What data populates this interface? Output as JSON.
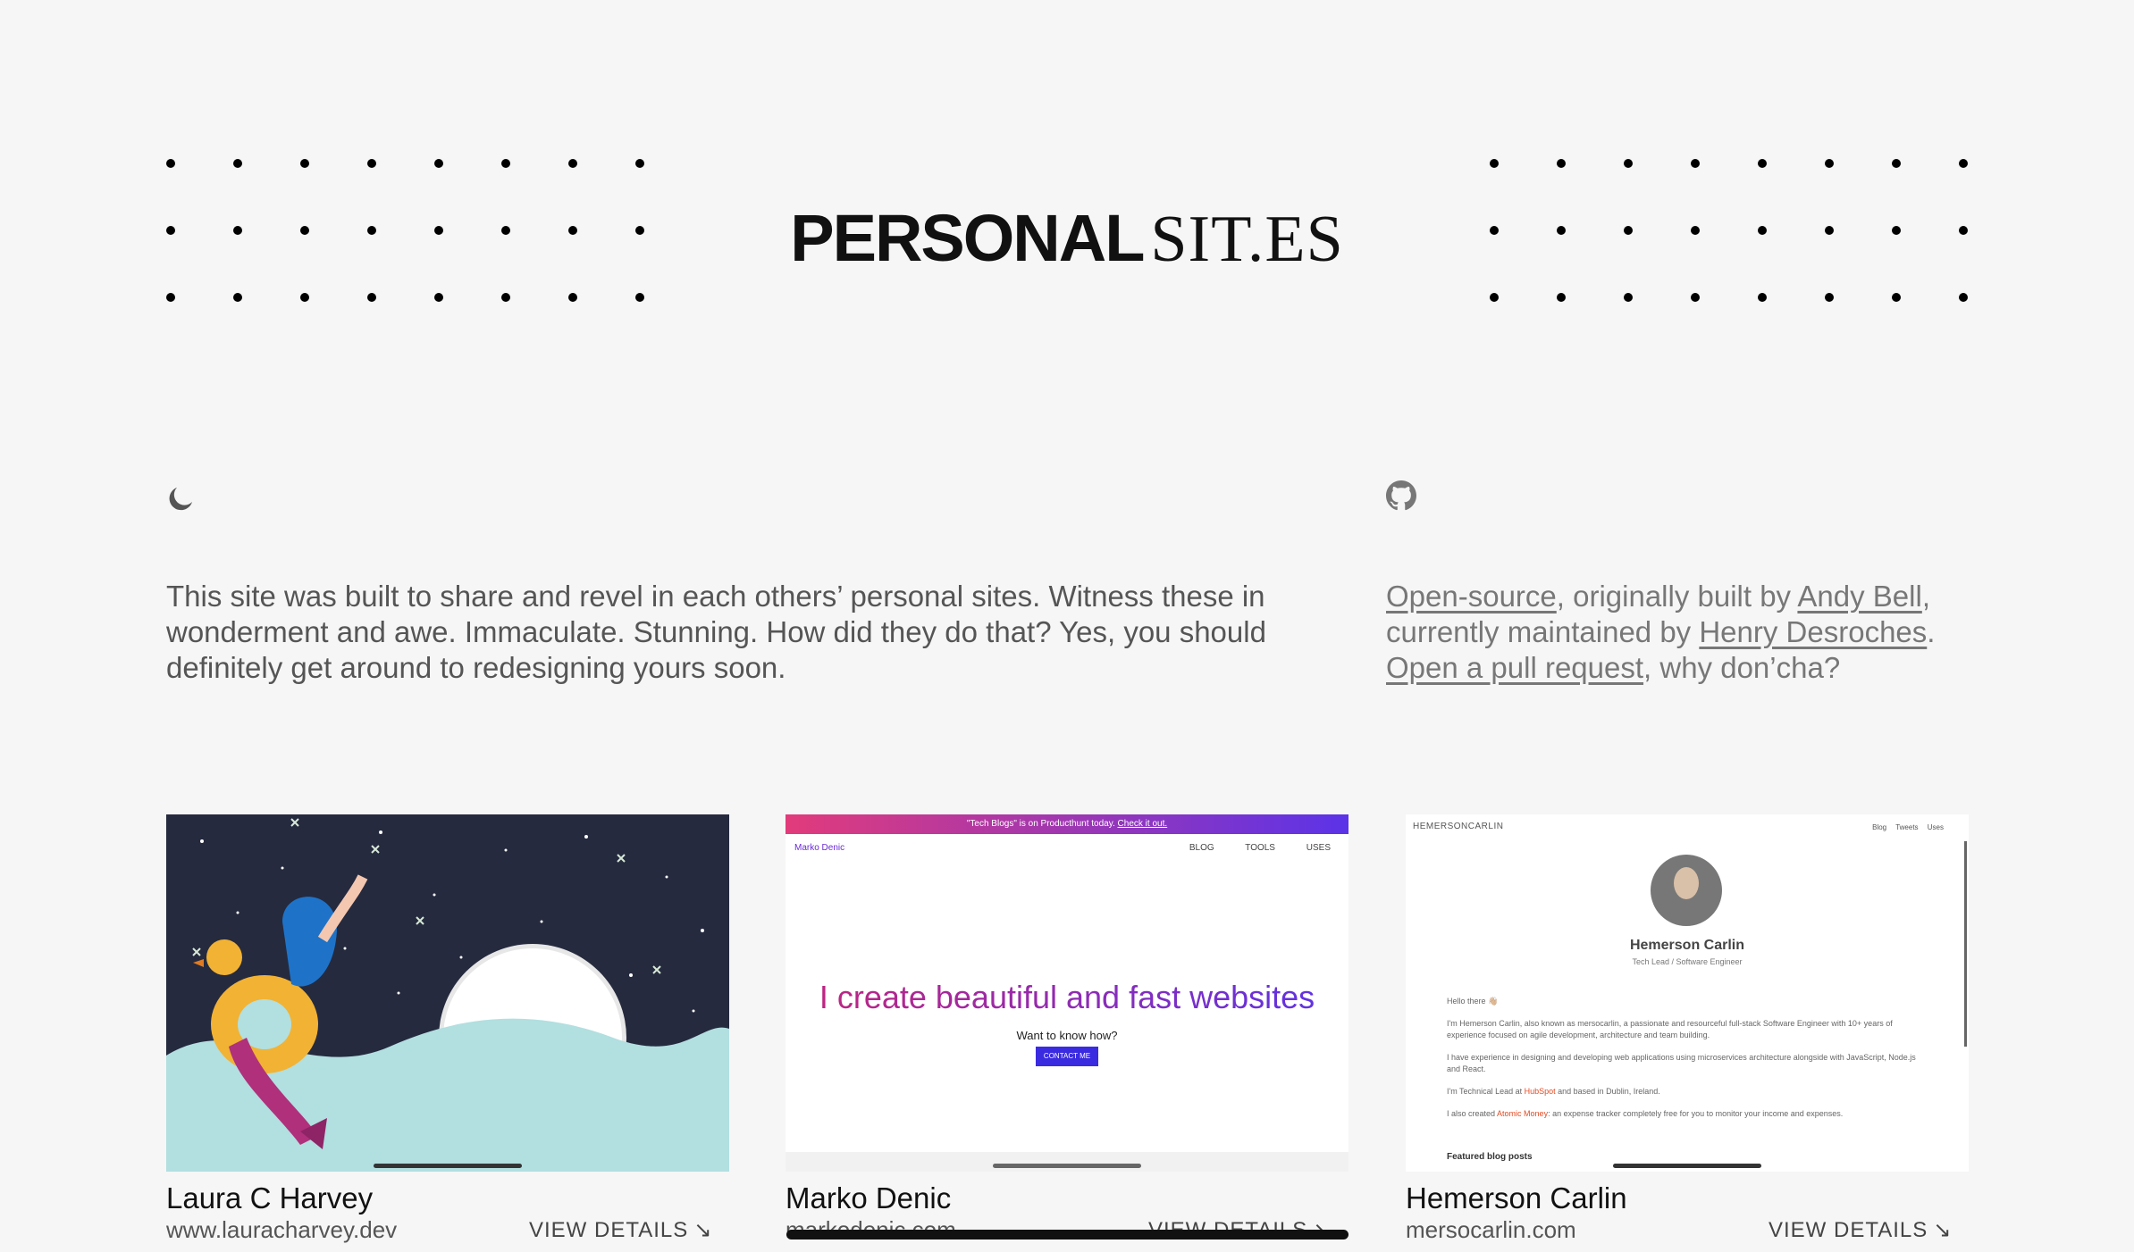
{
  "logo": {
    "bold": "PERSONAL",
    "thin": "SIT.ES"
  },
  "header": {
    "theme_toggle_icon": "moon-icon",
    "repo_icon": "github-icon"
  },
  "intro": "This site was built to share and revel in each others’ personal sites. Witness these in wonderment and awe. Immaculate. Stunning. How did they do that? Yes, you should definitely get around to redesigning yours soon.",
  "credits": {
    "link_open_source": "Open-source",
    "text_1": ", originally built by ",
    "link_andy": "Andy Bell",
    "text_2": ", currently maintained by ",
    "link_henry": "Henry Desroches",
    "text_3": ". ",
    "link_pr": "Open a pull request",
    "text_4": ", why don’cha?"
  },
  "cards": [
    {
      "name": "Laura C Harvey",
      "url": "www.lauracharvey.dev",
      "details": "VIEW DETAILS"
    },
    {
      "name": "Marko Denic",
      "url": "markodenic.com",
      "details": "VIEW DETAILS"
    },
    {
      "name": "Hemerson Carlin",
      "url": "mersocarlin.com",
      "details": "VIEW DETAILS"
    }
  ],
  "marko_shot": {
    "banner_text": "\"Tech Blogs\" is on Producthunt today.",
    "banner_link": "Check it out.",
    "logo": "Marko Denic",
    "nav": "BLOG TOOLS USES",
    "headline": "I create beautiful and fast websites",
    "subline": "Want to know how?",
    "cta": "CONTACT ME"
  },
  "hemerson_shot": {
    "logo": "HEMERSONCARLIN",
    "nav": "Blog Tweets Uses",
    "name": "Hemerson Carlin",
    "role": "Tech Lead / Software Engineer",
    "greeting": "Hello there 👋🏼",
    "p1": "I'm Hemerson Carlin, also known as mersocarlin, a passionate and resourceful full-stack Software Engineer with 10+ years of experience focused on agile development, architecture and team building.",
    "p2": "I have experience in designing and developing web applications using microservices architecture alongside with JavaScript, Node.js and React.",
    "p3_a": "I'm Technical Lead at ",
    "p3_link": "HubSpot",
    "p3_b": " and based in Dublin, Ireland.",
    "p4_a": "I also created ",
    "p4_link": "Atomic Money",
    "p4_b": ": an expense tracker completely free for you to monitor your income and expenses.",
    "featured": "Featured blog posts"
  },
  "colors": {
    "background": "#f6f6f6",
    "text": "#222222",
    "muted": "#777777",
    "marko_pink": "#e23b7b",
    "marko_purple": "#5b33e8",
    "hubspot": "#e44b23"
  }
}
